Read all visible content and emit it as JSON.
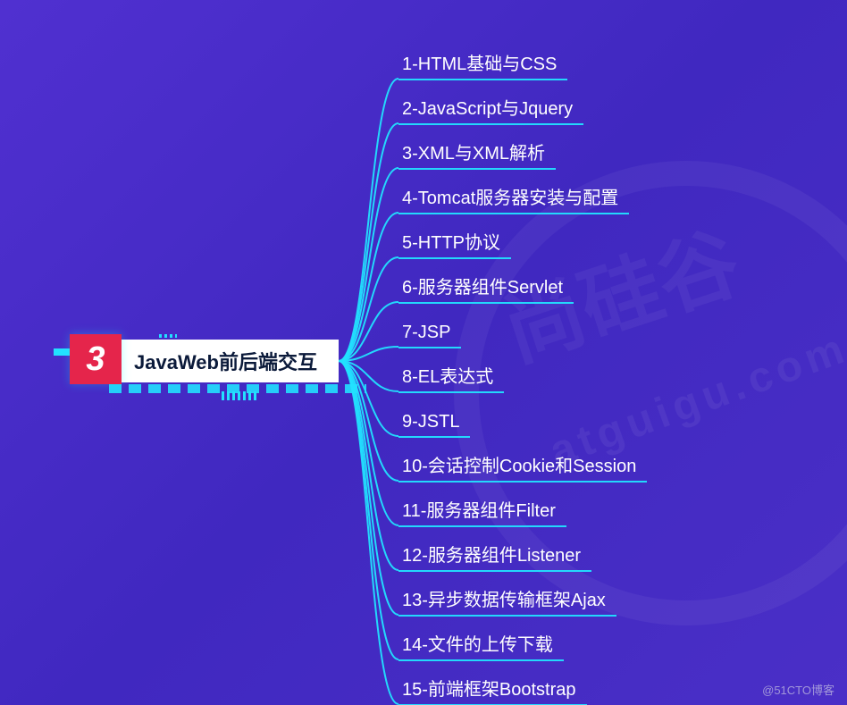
{
  "root": {
    "number": "3",
    "title": "JavaWeb前后端交互"
  },
  "children": [
    {
      "label": "1-HTML基础与CSS"
    },
    {
      "label": "2-JavaScript与Jquery"
    },
    {
      "label": "3-XML与XML解析"
    },
    {
      "label": "4-Tomcat服务器安装与配置"
    },
    {
      "label": "5-HTTP协议"
    },
    {
      "label": "6-服务器组件Servlet"
    },
    {
      "label": "7-JSP"
    },
    {
      "label": "8-EL表达式"
    },
    {
      "label": "9-JSTL"
    },
    {
      "label": "10-会话控制Cookie和Session"
    },
    {
      "label": "11-服务器组件Filter"
    },
    {
      "label": "12-服务器组件Listener"
    },
    {
      "label": "13-异步数据传输框架Ajax"
    },
    {
      "label": "14-文件的上传下载"
    },
    {
      "label": "15-前端框架Bootstrap"
    }
  ],
  "watermark": {
    "url": "atguigu.com",
    "chars": "尚硅谷",
    "footer": "@51CTO博客"
  },
  "colors": {
    "background": "#4a2fc7",
    "accent_red": "#e5254b",
    "accent_cyan": "#22e1ff",
    "node_bg": "#ffffff",
    "node_text": "#0b1a3a",
    "child_text": "#ffffff"
  }
}
